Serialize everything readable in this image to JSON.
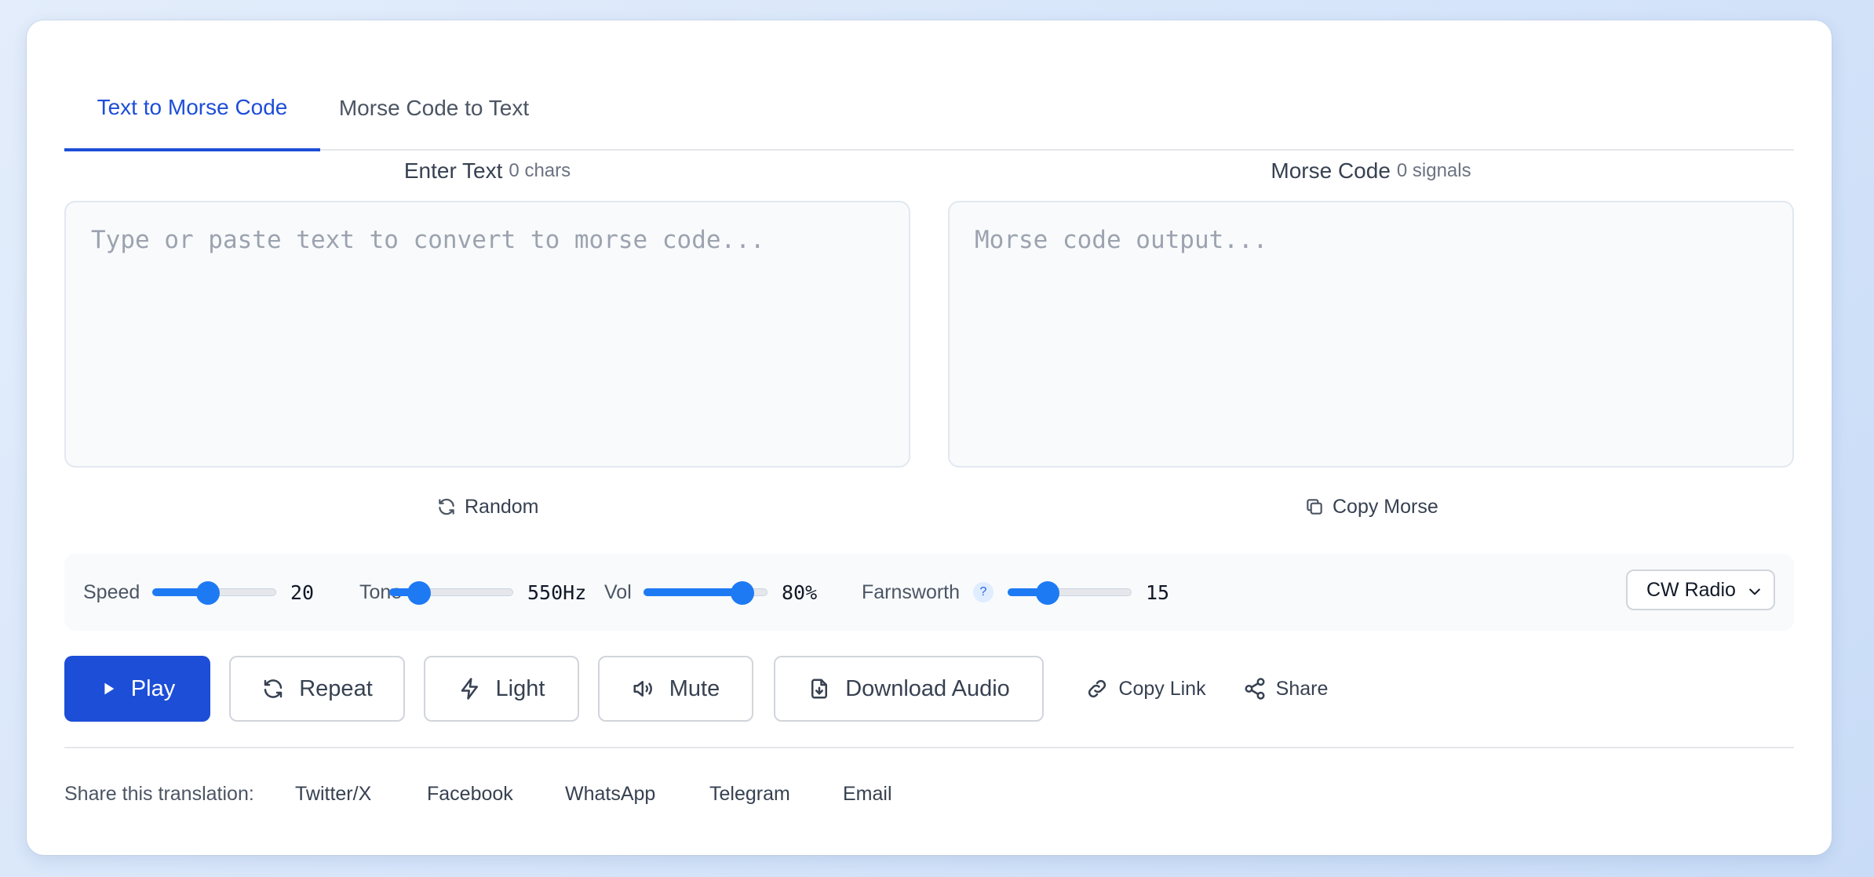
{
  "tabs": [
    {
      "label": "Text to Morse Code",
      "active": true
    },
    {
      "label": "Morse Code to Text",
      "active": false
    }
  ],
  "input_panel": {
    "title": "Enter Text",
    "count": "0 chars",
    "placeholder": "Type or paste text to convert to morse code...",
    "value": "",
    "action_label": "Random",
    "action_icon": "refresh-icon"
  },
  "output_panel": {
    "title": "Morse Code",
    "count": "0 signals",
    "placeholder": "Morse code output...",
    "value": "",
    "action_label": "Copy Morse",
    "action_icon": "copy-icon"
  },
  "controls": {
    "speed": {
      "label": "Speed",
      "value": "20",
      "level": 0.45
    },
    "tone": {
      "label": "Tone",
      "value": "550Hz",
      "level": 0.24
    },
    "volume": {
      "label": "Vol",
      "value": "80%",
      "level": 0.8
    },
    "farnsworth": {
      "label": "Farnsworth",
      "help": "?",
      "value": "15",
      "level": 0.32
    },
    "sound_select": {
      "value": "CW Radio"
    }
  },
  "buttons": {
    "play": {
      "label": "Play",
      "icon": "play-icon"
    },
    "repeat": {
      "label": "Repeat",
      "icon": "repeat-icon"
    },
    "light": {
      "label": "Light",
      "icon": "lightning-icon"
    },
    "mute": {
      "label": "Mute",
      "icon": "speaker-icon"
    },
    "download": {
      "label": "Download Audio",
      "icon": "file-download-icon"
    },
    "copy_link": {
      "label": "Copy Link",
      "icon": "link-icon"
    },
    "share": {
      "label": "Share",
      "icon": "share-icon"
    }
  },
  "share_bar": {
    "label": "Share this translation:",
    "links": [
      "Twitter/X",
      "Facebook",
      "WhatsApp",
      "Telegram",
      "Email"
    ]
  },
  "colors": {
    "accent": "#1d4ed8",
    "slider": "#1d7af3",
    "background": "#dbe7fa"
  }
}
